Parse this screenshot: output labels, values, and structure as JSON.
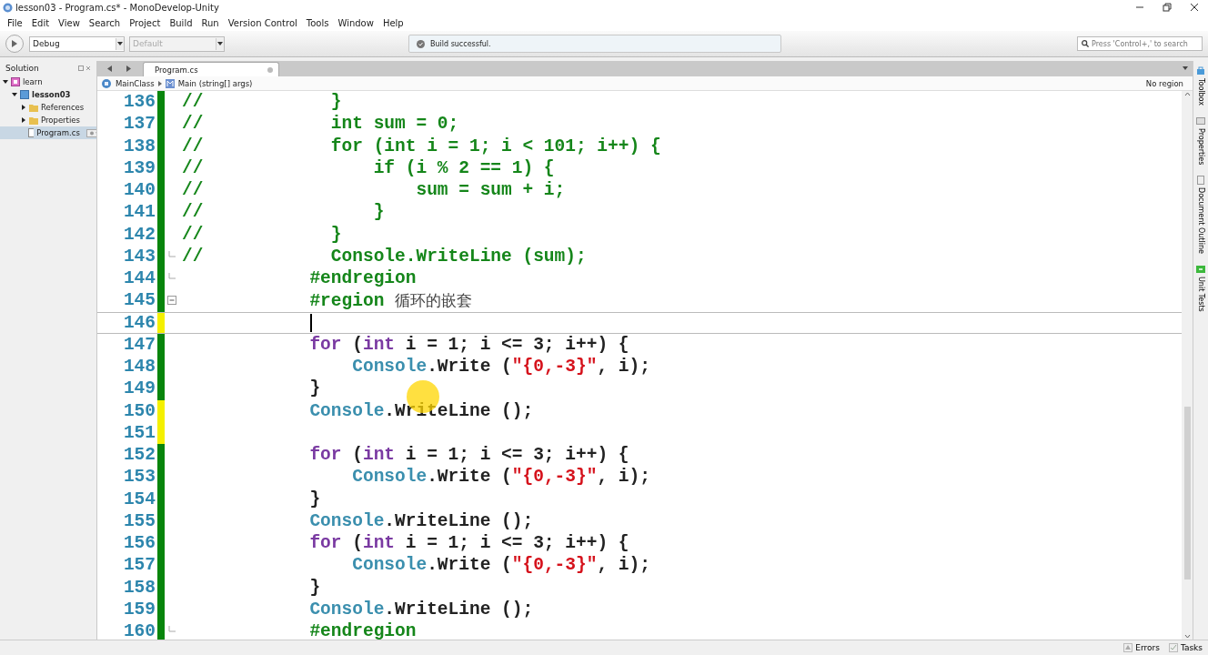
{
  "window": {
    "title": "lesson03 - Program.cs* - MonoDevelop-Unity"
  },
  "menu": [
    "File",
    "Edit",
    "View",
    "Search",
    "Project",
    "Build",
    "Run",
    "Version Control",
    "Tools",
    "Window",
    "Help"
  ],
  "toolbar": {
    "configuration": "Debug",
    "target": {
      "value": "Default",
      "disabled": true
    },
    "status": "Build successful.",
    "search": {
      "placeholder": "Press 'Control+,' to search"
    }
  },
  "solution_pad": {
    "title": "Solution",
    "tree": [
      {
        "label": "learn",
        "kind": "solution",
        "expanded": true,
        "selected": false,
        "children": [
          {
            "label": "lesson03",
            "kind": "project",
            "expanded": true,
            "selected": false,
            "children": [
              {
                "label": "References",
                "kind": "folder",
                "expanded": false,
                "selected": false
              },
              {
                "label": "Properties",
                "kind": "folder",
                "expanded": false,
                "selected": false
              },
              {
                "label": "Program.cs",
                "kind": "file",
                "selected": true
              }
            ]
          }
        ]
      }
    ]
  },
  "tabs": [
    {
      "label": "Program.cs",
      "selected": true
    }
  ],
  "breadcrumb": {
    "class": "MainClass",
    "method": "Main (string[] args)",
    "region": "No region"
  },
  "code": [
    {
      "number": "136",
      "unsaved": false,
      "fold_start": false,
      "fold_end": false,
      "current": false,
      "segments": [
        {
          "kind": "comment",
          "text": "//            }"
        }
      ]
    },
    {
      "number": "137",
      "unsaved": false,
      "fold_start": false,
      "fold_end": false,
      "current": false,
      "segments": [
        {
          "kind": "comment",
          "text": "//            int sum = 0;"
        }
      ]
    },
    {
      "number": "138",
      "unsaved": false,
      "fold_start": false,
      "fold_end": false,
      "current": false,
      "segments": [
        {
          "kind": "comment",
          "text": "//            for (int i = 1; i < 101; i++) {"
        }
      ]
    },
    {
      "number": "139",
      "unsaved": false,
      "fold_start": false,
      "fold_end": false,
      "current": false,
      "segments": [
        {
          "kind": "comment",
          "text": "//                if (i % 2 == 1) {"
        }
      ]
    },
    {
      "number": "140",
      "unsaved": false,
      "fold_start": false,
      "fold_end": false,
      "current": false,
      "segments": [
        {
          "kind": "comment",
          "text": "//                    sum = sum + i;"
        }
      ]
    },
    {
      "number": "141",
      "unsaved": false,
      "fold_start": false,
      "fold_end": false,
      "current": false,
      "segments": [
        {
          "kind": "comment",
          "text": "//                }"
        }
      ]
    },
    {
      "number": "142",
      "unsaved": false,
      "fold_start": false,
      "fold_end": false,
      "current": false,
      "segments": [
        {
          "kind": "comment",
          "text": "//            }"
        }
      ]
    },
    {
      "number": "143",
      "unsaved": false,
      "fold_start": false,
      "fold_end": true,
      "current": false,
      "segments": [
        {
          "kind": "comment",
          "text": "//            Console.WriteLine (sum);"
        }
      ]
    },
    {
      "number": "144",
      "unsaved": false,
      "fold_start": false,
      "fold_end": true,
      "current": false,
      "segments": [
        {
          "kind": "directive",
          "text": "            #endregion"
        }
      ]
    },
    {
      "number": "145",
      "unsaved": false,
      "fold_start": true,
      "fold_end": false,
      "current": false,
      "segments": [
        {
          "kind": "directive",
          "text": "            #region "
        },
        {
          "kind": "text",
          "text": "循环的嵌套"
        }
      ]
    },
    {
      "number": "146",
      "unsaved": true,
      "fold_start": false,
      "fold_end": false,
      "current": true
    },
    {
      "number": "147",
      "unsaved": false,
      "fold_start": false,
      "fold_end": false,
      "current": false,
      "segments": [
        {
          "kind": "keyword",
          "text": "            for"
        },
        {
          "kind": "plain",
          "text": " ("
        },
        {
          "kind": "keyword",
          "text": "int"
        },
        {
          "kind": "plain",
          "text": " i = 1; i <= 3; i++) {"
        }
      ]
    },
    {
      "number": "148",
      "unsaved": false,
      "fold_start": false,
      "fold_end": false,
      "current": false,
      "segments": [
        {
          "kind": "type",
          "text": "                Console"
        },
        {
          "kind": "plain",
          "text": ".Write ("
        },
        {
          "kind": "string",
          "text": "\"{0,-3}\""
        },
        {
          "kind": "plain",
          "text": ", i);"
        }
      ]
    },
    {
      "number": "149",
      "unsaved": false,
      "fold_start": false,
      "fold_end": false,
      "current": false,
      "segments": [
        {
          "kind": "plain",
          "text": "            }"
        }
      ]
    },
    {
      "number": "150",
      "unsaved": true,
      "fold_start": false,
      "fold_end": false,
      "current": false,
      "segments": [
        {
          "kind": "type",
          "text": "            Console"
        },
        {
          "kind": "plain",
          "text": ".WriteLine ();"
        }
      ]
    },
    {
      "number": "151",
      "unsaved": true,
      "fold_start": false,
      "fold_end": false,
      "current": false
    },
    {
      "number": "152",
      "unsaved": false,
      "fold_start": false,
      "fold_end": false,
      "current": false,
      "segments": [
        {
          "kind": "keyword",
          "text": "            for"
        },
        {
          "kind": "plain",
          "text": " ("
        },
        {
          "kind": "keyword",
          "text": "int"
        },
        {
          "kind": "plain",
          "text": " i = 1; i <= 3; i++) {"
        }
      ]
    },
    {
      "number": "153",
      "unsaved": false,
      "fold_start": false,
      "fold_end": false,
      "current": false,
      "segments": [
        {
          "kind": "type",
          "text": "                Console"
        },
        {
          "kind": "plain",
          "text": ".Write ("
        },
        {
          "kind": "string",
          "text": "\"{0,-3}\""
        },
        {
          "kind": "plain",
          "text": ", i);"
        }
      ]
    },
    {
      "number": "154",
      "unsaved": false,
      "fold_start": false,
      "fold_end": false,
      "current": false,
      "segments": [
        {
          "kind": "plain",
          "text": "            }"
        }
      ]
    },
    {
      "number": "155",
      "unsaved": false,
      "fold_start": false,
      "fold_end": false,
      "current": false,
      "segments": [
        {
          "kind": "type",
          "text": "            Console"
        },
        {
          "kind": "plain",
          "text": ".WriteLine ();"
        }
      ]
    },
    {
      "number": "156",
      "unsaved": false,
      "fold_start": false,
      "fold_end": false,
      "current": false,
      "segments": [
        {
          "kind": "keyword",
          "text": "            for"
        },
        {
          "kind": "plain",
          "text": " ("
        },
        {
          "kind": "keyword",
          "text": "int"
        },
        {
          "kind": "plain",
          "text": " i = 1; i <= 3; i++) {"
        }
      ]
    },
    {
      "number": "157",
      "unsaved": false,
      "fold_start": false,
      "fold_end": false,
      "current": false,
      "segments": [
        {
          "kind": "type",
          "text": "                Console"
        },
        {
          "kind": "plain",
          "text": ".Write ("
        },
        {
          "kind": "string",
          "text": "\"{0,-3}\""
        },
        {
          "kind": "plain",
          "text": ", i);"
        }
      ]
    },
    {
      "number": "158",
      "unsaved": false,
      "fold_start": false,
      "fold_end": false,
      "current": false,
      "segments": [
        {
          "kind": "plain",
          "text": "            }"
        }
      ]
    },
    {
      "number": "159",
      "unsaved": false,
      "fold_start": false,
      "fold_end": false,
      "current": false,
      "segments": [
        {
          "kind": "type",
          "text": "            Console"
        },
        {
          "kind": "plain",
          "text": ".WriteLine ();"
        }
      ]
    },
    {
      "number": "160",
      "unsaved": false,
      "fold_start": false,
      "fold_end": true,
      "current": false,
      "segments": [
        {
          "kind": "directive",
          "text": "            #endregion"
        }
      ]
    }
  ],
  "dock": [
    "Toolbox",
    "Properties",
    "Document Outline",
    "Unit Tests"
  ],
  "status_bar": [
    "Errors",
    "Tasks"
  ]
}
